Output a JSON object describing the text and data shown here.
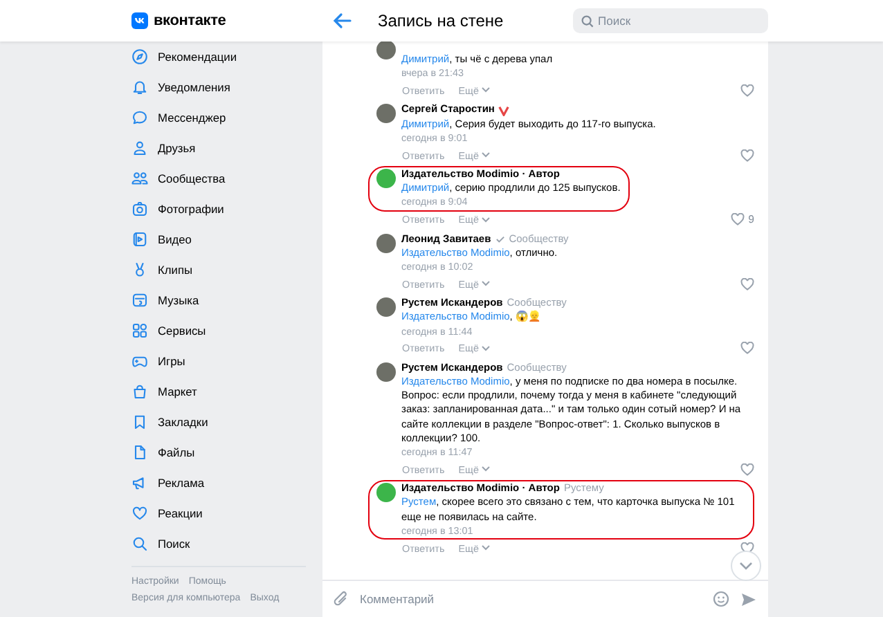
{
  "header": {
    "logo_text": "вконтакте",
    "title": "Запись на стене",
    "search": {
      "placeholder": "Поиск"
    }
  },
  "sidebar": {
    "items": [
      {
        "label": "Рекомендации"
      },
      {
        "label": "Уведомления"
      },
      {
        "label": "Мессенджер"
      },
      {
        "label": "Друзья"
      },
      {
        "label": "Сообщества"
      },
      {
        "label": "Фотографии"
      },
      {
        "label": "Видео"
      },
      {
        "label": "Клипы"
      },
      {
        "label": "Музыка"
      },
      {
        "label": "Сервисы"
      },
      {
        "label": "Игры"
      },
      {
        "label": "Маркет"
      },
      {
        "label": "Закладки"
      },
      {
        "label": "Файлы"
      },
      {
        "label": "Реклама"
      },
      {
        "label": "Реакции"
      },
      {
        "label": "Поиск"
      }
    ],
    "footer_links": [
      [
        "Настройки",
        "Помощь"
      ],
      [
        "Версия для компьютера",
        "Выход"
      ]
    ]
  },
  "comments": [
    {
      "kind": "person",
      "mention": "Димитрий",
      "text": ", ты чё с дерева упал",
      "time": "вчера в 21:43",
      "actions": [
        "Ответить",
        "Ещё"
      ],
      "highlighted": false
    },
    {
      "kind": "person",
      "author": "Сергей Старостин",
      "donor": true,
      "verified": false,
      "mention": "Димитрий",
      "text": ", Серия будет выходить до 117-го выпуска.",
      "time": "сегодня в 9:01",
      "actions": [
        "Ответить",
        "Ещё"
      ],
      "highlighted": false
    },
    {
      "kind": "community",
      "author": "Издательство Modimio · Автор",
      "donor": false,
      "verified": false,
      "mention": "Димитрий",
      "text": ", серию продлили до 125 выпусков.",
      "time": "сегодня в 9:04",
      "actions": [
        "Ответить",
        "Ещё"
      ],
      "likes": "9",
      "highlighted": true
    },
    {
      "kind": "person",
      "author": "Леонид Завитаев",
      "donor": false,
      "verified": true,
      "reply_to": "Сообществу",
      "mention": "Издательство Modimio",
      "text": ", отлично.",
      "time": "сегодня в 10:02",
      "actions": [
        "Ответить",
        "Ещё"
      ],
      "highlighted": false
    },
    {
      "kind": "person",
      "author": "Рустем Искандеров",
      "donor": false,
      "verified": false,
      "reply_to": "Сообществу",
      "mention": "Издательство Modimio",
      "text": ", 😱👱",
      "time": "сегодня в 11:44",
      "actions": [
        "Ответить",
        "Ещё"
      ],
      "highlighted": false
    },
    {
      "kind": "person",
      "author": "Рустем Искандеров",
      "donor": false,
      "verified": false,
      "reply_to": "Сообществу",
      "mention": "Издательство Modimio",
      "text": ", у меня по подписке по два номера в посылке. Вопрос: если продлили, почему тогда у меня в кабинете \"следующий заказ: запланированная дата...\" и там только один сотый номер? И на сайте коллекции в разделе \"Вопрос-ответ\": 1. Сколько выпусков в коллекции? 100.",
      "time": "сегодня в 11:47",
      "actions": [
        "Ответить",
        "Ещё"
      ],
      "highlighted": false
    },
    {
      "kind": "community",
      "author": "Издательство Modimio · Автор",
      "donor": false,
      "verified": false,
      "reply_to": "Рустему",
      "mention": "Рустем",
      "text": ", скорее всего это связано с тем, что карточка выпуска № 101 еще не появилась на сайте.",
      "time": "сегодня в 13:01",
      "actions": [
        "Ответить",
        "Ещё"
      ],
      "highlighted": true
    }
  ],
  "composer": {
    "placeholder": "Комментарий"
  }
}
